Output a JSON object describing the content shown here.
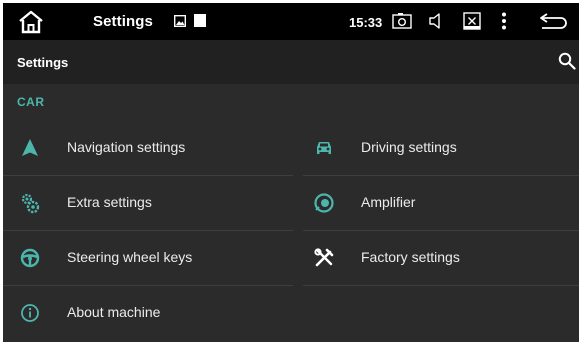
{
  "status_bar": {
    "title": "Settings",
    "time": "15:33"
  },
  "app_bar": {
    "title": "Settings"
  },
  "section": {
    "header": "CAR"
  },
  "items": {
    "navigation": {
      "label": "Navigation settings",
      "icon": "navigation-arrow-icon"
    },
    "driving": {
      "label": "Driving settings",
      "icon": "car-icon"
    },
    "extra": {
      "label": "Extra settings",
      "icon": "gears-icon"
    },
    "amplifier": {
      "label": "Amplifier",
      "icon": "speaker-icon"
    },
    "steering": {
      "label": "Steering wheel keys",
      "icon": "steering-wheel-icon"
    },
    "factory": {
      "label": "Factory settings",
      "icon": "tools-icon"
    },
    "about": {
      "label": "About machine",
      "icon": "info-icon"
    }
  },
  "colors": {
    "accent": "#4db6ac",
    "background": "#2b2b2b",
    "app_bar": "#212121",
    "status_bar": "#000000",
    "text": "#ececec"
  }
}
